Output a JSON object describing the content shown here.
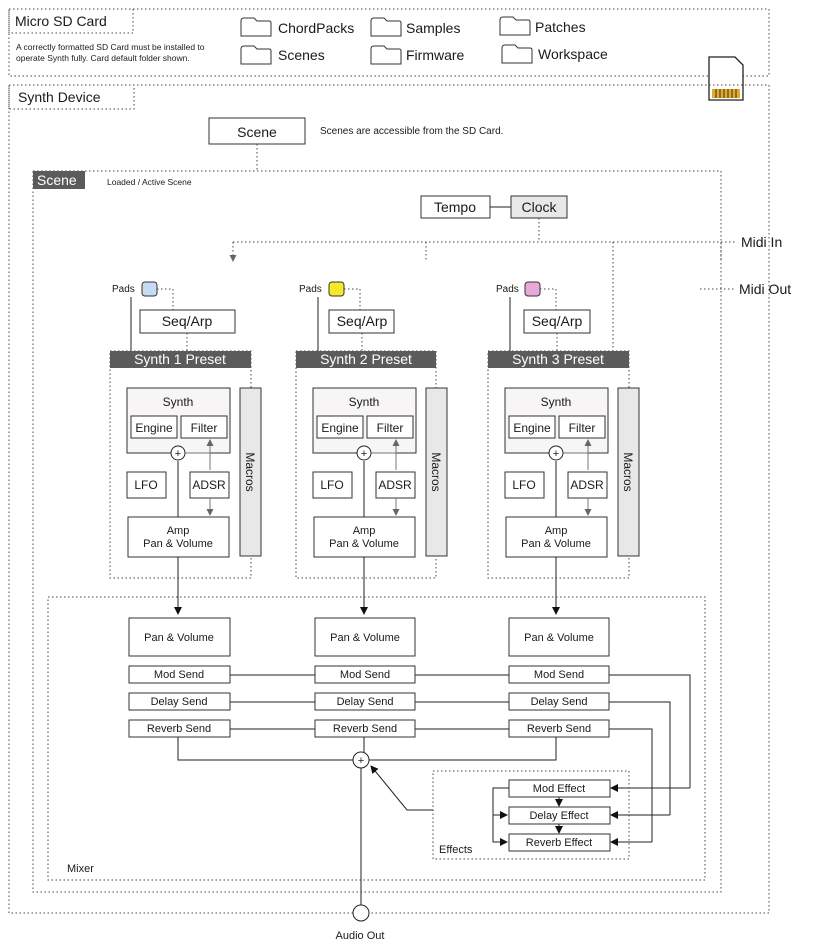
{
  "sd_card": {
    "title": "Micro SD Card",
    "note_line1": "A correctly formatted SD Card must be installed to",
    "note_line2": "operate Synth fully. Card default folder shown.",
    "folders": [
      "ChordPacks",
      "Samples",
      "Patches",
      "Scenes",
      "Firmware",
      "Workspace"
    ]
  },
  "device": {
    "title": "Synth Device",
    "scene_button": "Scene",
    "scene_note": "Scenes are accessible from the SD Card.",
    "scene_tag": "Scene",
    "scene_tag_note": "Loaded / Active Scene",
    "tempo": "Tempo",
    "clock": "Clock",
    "midi_in": "Midi In",
    "midi_out": "Midi Out",
    "audio_out": "Audio Out"
  },
  "synths": [
    {
      "pads": "Pads",
      "pad_color": "#c5dcf2",
      "seq": "Seq/Arp",
      "preset": "Synth 1 Preset",
      "synth": "Synth",
      "engine": "Engine",
      "filter": "Filter",
      "lfo": "LFO",
      "adsr": "ADSR",
      "amp_line1": "Amp",
      "amp_line2": "Pan & Volume",
      "macros": "Macros"
    },
    {
      "pads": "Pads",
      "pad_color": "#f5e92a",
      "seq": "Seq/Arp",
      "preset": "Synth 2 Preset",
      "synth": "Synth",
      "engine": "Engine",
      "filter": "Filter",
      "lfo": "LFO",
      "adsr": "ADSR",
      "amp_line1": "Amp",
      "amp_line2": "Pan & Volume",
      "macros": "Macros"
    },
    {
      "pads": "Pads",
      "pad_color": "#e8a9d9",
      "seq": "Seq/Arp",
      "preset": "Synth 3 Preset",
      "synth": "Synth",
      "engine": "Engine",
      "filter": "Filter",
      "lfo": "LFO",
      "adsr": "ADSR",
      "amp_line1": "Amp",
      "amp_line2": "Pan & Volume",
      "macros": "Macros"
    }
  ],
  "mixer": {
    "label": "Mixer",
    "channels": [
      {
        "pan": "Pan & Volume",
        "mod": "Mod Send",
        "delay": "Delay Send",
        "reverb": "Reverb Send"
      },
      {
        "pan": "Pan & Volume",
        "mod": "Mod Send",
        "delay": "Delay Send",
        "reverb": "Reverb Send"
      },
      {
        "pan": "Pan & Volume",
        "mod": "Mod Send",
        "delay": "Delay Send",
        "reverb": "Reverb Send"
      }
    ],
    "effects_label": "Effects",
    "mod_effect": "Mod Effect",
    "delay_effect": "Delay Effect",
    "reverb_effect": "Reverb Effect"
  }
}
